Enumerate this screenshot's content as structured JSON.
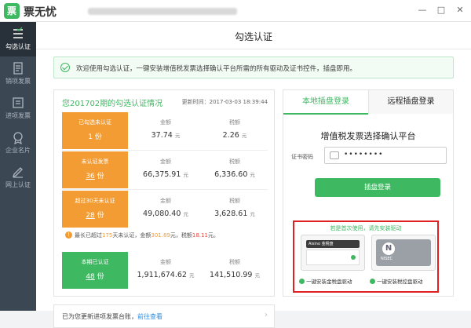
{
  "app": {
    "logo_char": "票",
    "name": "票无忧"
  },
  "window": {
    "min": "—",
    "max": "□",
    "close": "✕"
  },
  "sidebar": {
    "items": [
      {
        "label": "勾选认证",
        "active": true
      },
      {
        "label": "销项发票"
      },
      {
        "label": "进项发票"
      },
      {
        "label": "企业名片"
      },
      {
        "label": "网上认证"
      }
    ]
  },
  "page": {
    "title": "勾选认证",
    "banner": "欢迎使用勾选认证，一键安装增值税发票选择确认平台所需的所有驱动及证书控件，插盘即用。"
  },
  "summary": {
    "title": "您201702期的勾选认证情况",
    "update_time": "更新时间：2017-03-03 18:39:44",
    "amount_header": "金额",
    "tax_header": "税额",
    "unit_yuan": "元",
    "unit_fen": "份",
    "rows": [
      {
        "label": "已勾选未认证",
        "count": "1",
        "amount": "37.74",
        "tax": "2.26",
        "color": "#f39c33"
      },
      {
        "label": "未认证发票",
        "count": "36",
        "amount": "66,375.91",
        "tax": "6,336.60",
        "color": "#f39c33"
      },
      {
        "label": "超过30天未认证",
        "count": "28",
        "amount": "49,080.40",
        "tax": "3,628.61",
        "color": "#f39c33"
      },
      {
        "label": "本期已认证",
        "count": "48",
        "amount": "1,911,674.62",
        "tax": "141,510.99",
        "color": "#3eb861"
      }
    ],
    "note": {
      "prefix": "最长已超过",
      "days": "175",
      "mid": "天未认证，金额",
      "amount": "301.89",
      "mid2": "元，税额",
      "tax": "18.11",
      "suffix": "元。"
    }
  },
  "update_bar": {
    "text": "已为您更新进项发票台账，",
    "link": "前往查看",
    "arrow": "›"
  },
  "right_panel": {
    "tabs": [
      "本地插盘登录",
      "远程插盘登录"
    ],
    "title": "增值税发票选择确认平台",
    "cert_label": "证书密码",
    "cert_value": "••••••••",
    "login_button": "插盘登录",
    "hint": "若是首次使用，请先安装驱动",
    "device1_bar": "Aisino 金税盘",
    "device2_logo": "N",
    "device2_text": "NISEC",
    "driver1": "一键安装金税盘驱动",
    "driver2": "一键安装税控盘驱动"
  },
  "colors": {
    "accent": "#3eb861",
    "orange": "#f39c33",
    "red": "#e34b3c",
    "sidebar": "#3b4752"
  }
}
